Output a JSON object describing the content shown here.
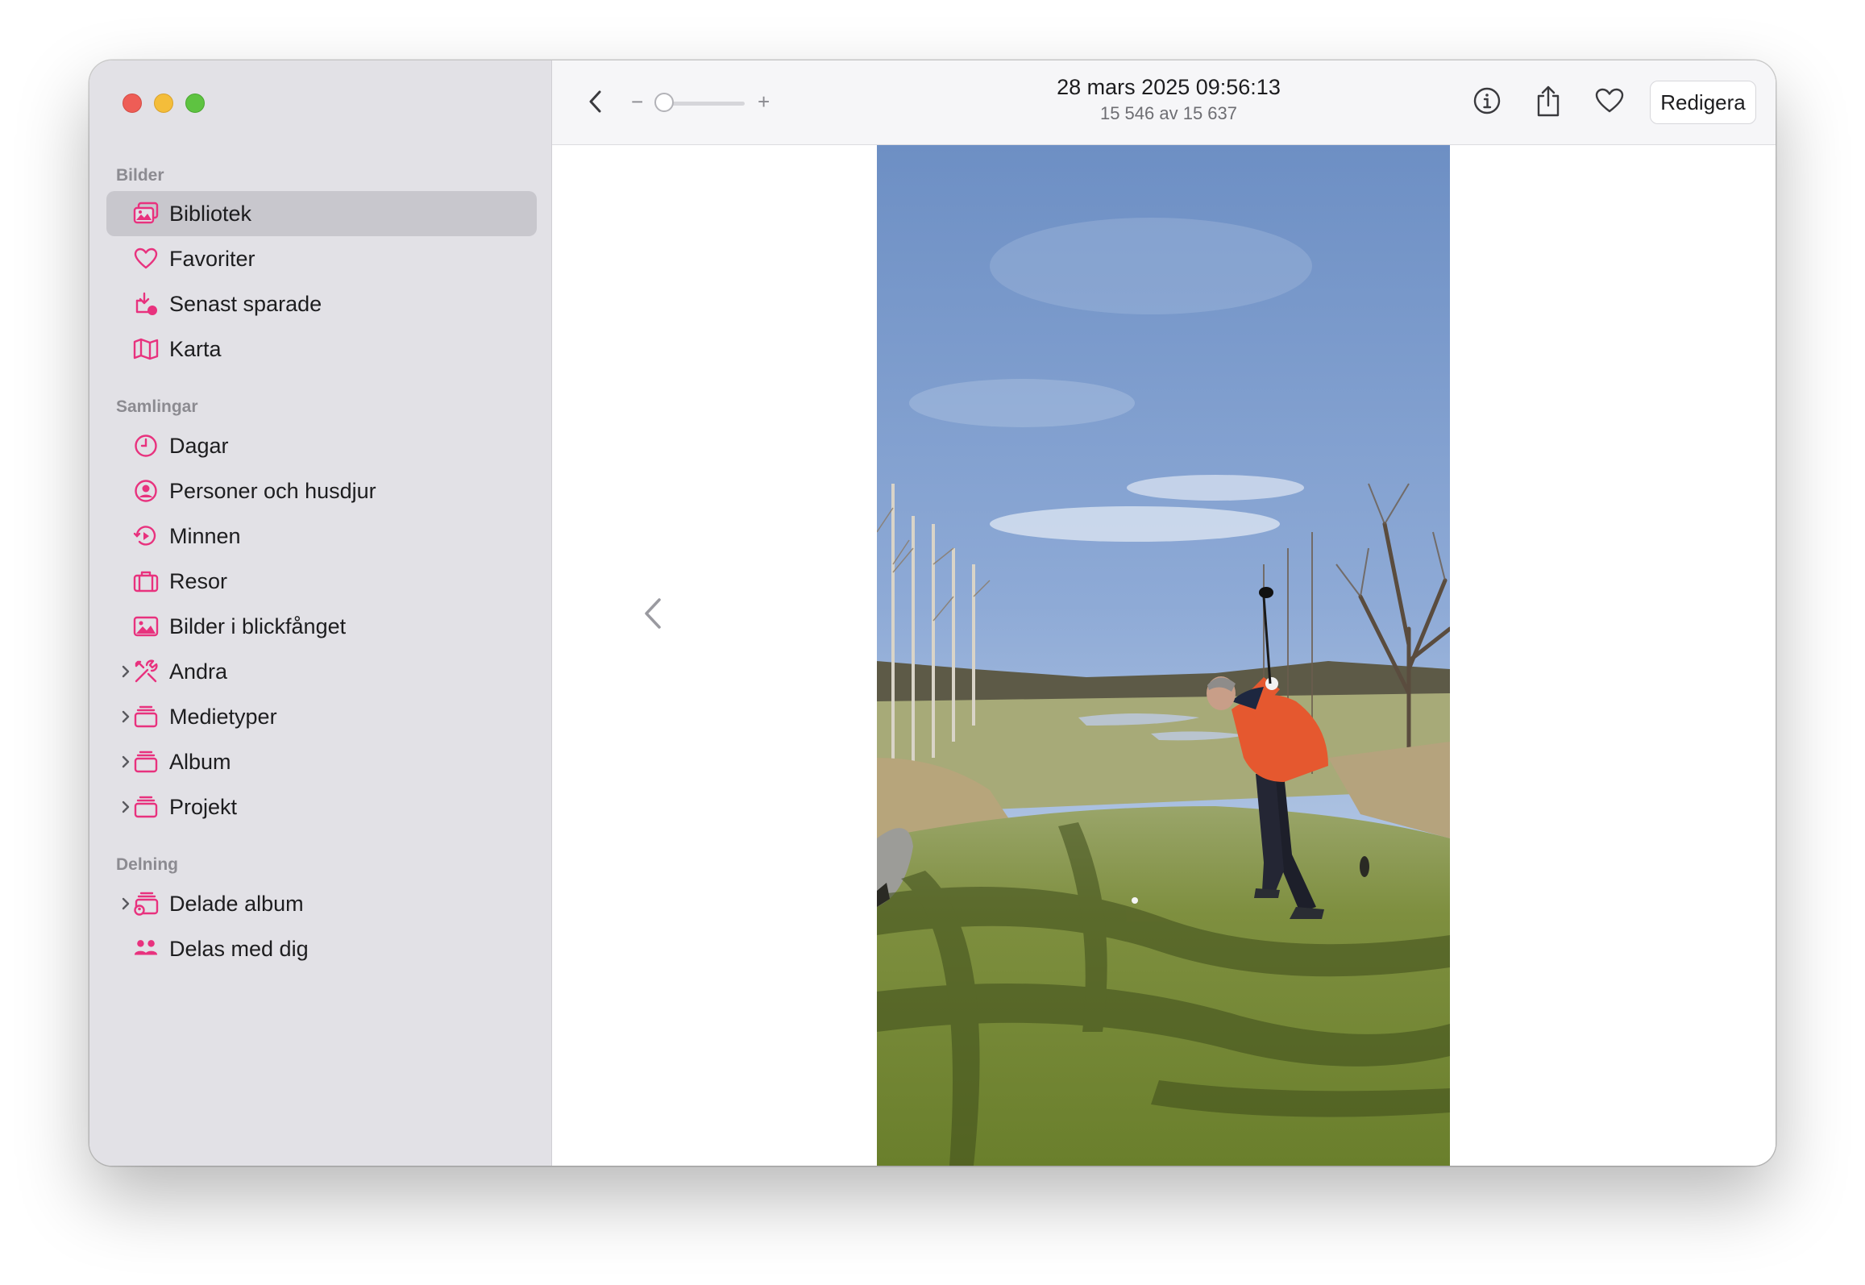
{
  "window": {
    "sidebar": {
      "sections": [
        {
          "header": "Bilder",
          "items": [
            {
              "label": "Bibliotek",
              "icon": "photo-library-icon",
              "selected": true
            },
            {
              "label": "Favoriter",
              "icon": "heart-icon"
            },
            {
              "label": "Senast sparade",
              "icon": "recently-saved-icon"
            },
            {
              "label": "Karta",
              "icon": "map-icon"
            }
          ]
        },
        {
          "header": "Samlingar",
          "items": [
            {
              "label": "Dagar",
              "icon": "clock-icon"
            },
            {
              "label": "Personer och husdjur",
              "icon": "person-circle-icon"
            },
            {
              "label": "Minnen",
              "icon": "memories-icon"
            },
            {
              "label": "Resor",
              "icon": "suitcase-icon"
            },
            {
              "label": "Bilder i blickfånget",
              "icon": "featured-photo-icon"
            },
            {
              "label": "Andra",
              "icon": "tools-icon",
              "expandable": true
            },
            {
              "label": "Medietyper",
              "icon": "stack-icon",
              "expandable": true
            },
            {
              "label": "Album",
              "icon": "stack-icon",
              "expandable": true
            },
            {
              "label": "Projekt",
              "icon": "stack-icon",
              "expandable": true
            }
          ]
        },
        {
          "header": "Delning",
          "items": [
            {
              "label": "Delade album",
              "icon": "shared-album-icon",
              "expandable": true
            },
            {
              "label": "Delas med dig",
              "icon": "shared-with-you-icon"
            }
          ]
        }
      ]
    },
    "toolbar": {
      "date": "28 mars 2025 09:56:13",
      "count": "15 546 av 15 637",
      "zoom_minus": "−",
      "zoom_plus": "+",
      "zoom_level": 0.0,
      "edit_label": "Redigera"
    },
    "colors": {
      "accent": "#e8327e",
      "sidebar_bg": "#e2e1e6",
      "selected_bg": "#c8c7cd"
    }
  }
}
